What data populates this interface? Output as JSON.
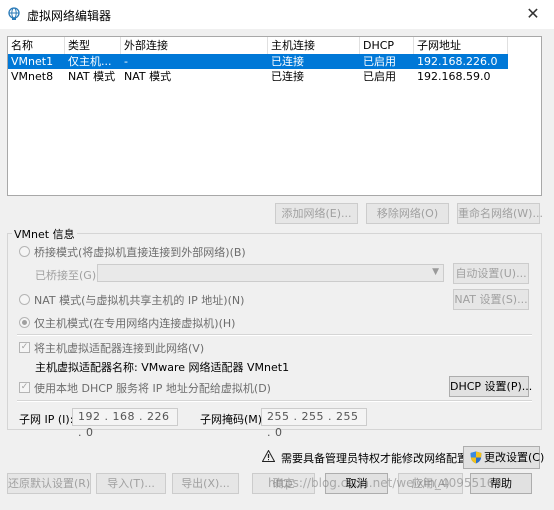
{
  "window": {
    "title": "虚拟网络编辑器",
    "close_glyph": "✕"
  },
  "table": {
    "columns": [
      "名称",
      "类型",
      "外部连接",
      "主机连接",
      "DHCP",
      "子网地址"
    ],
    "rows": [
      [
        "VMnet1",
        "仅主机...",
        "-",
        "已连接",
        "已启用",
        "192.168.226.0"
      ],
      [
        "VMnet8",
        "NAT 模式",
        "NAT 模式",
        "已连接",
        "已启用",
        "192.168.59.0"
      ]
    ],
    "selected_row": 0
  },
  "list_buttons": {
    "add": "添加网络(E)...",
    "remove": "移除网络(O)",
    "rename": "重命名网络(W)..."
  },
  "vmnet_info": {
    "title": "VMnet 信息",
    "bridged_label": "桥接模式(将虚拟机直接连接到外部网络)(B)",
    "bridged_to_label": "已桥接至(G):",
    "auto_settings": "自动设置(U)...",
    "nat_label": "NAT 模式(与虚拟机共享主机的 IP 地址)(N)",
    "nat_settings": "NAT 设置(S)...",
    "host_only_label": "仅主机模式(在专用网络内连接虚拟机)(H)",
    "connect_adapter_label": "将主机虚拟适配器连接到此网络(V)",
    "adapter_name_label": "主机虚拟适配器名称: VMware 网络适配器 VMnet1",
    "dhcp_label": "使用本地 DHCP 服务将 IP 地址分配给虚拟机(D)",
    "dhcp_settings": "DHCP 设置(P)...",
    "subnet_ip_label": "子网 IP (I):",
    "subnet_ip_value": "192 . 168 . 226 .   0",
    "subnet_mask_label": "子网掩码(M):",
    "subnet_mask_value": "255 . 255 . 255 .   0"
  },
  "admin_notice": "需要具备管理员特权才能修改网络配置。",
  "change_settings": "更改设置(C)",
  "bottom_buttons": {
    "restore": "还原默认设置(R)",
    "import": "导入(T)...",
    "export": "导出(X)...",
    "ok": "确定",
    "cancel": "取消",
    "apply": "应用(A)",
    "help": "帮助"
  },
  "watermark": "https://blog.csdn.net/weixin_40955163",
  "colors": {
    "selection": "#0078d7",
    "disabled_text": "#a0a0a0"
  }
}
